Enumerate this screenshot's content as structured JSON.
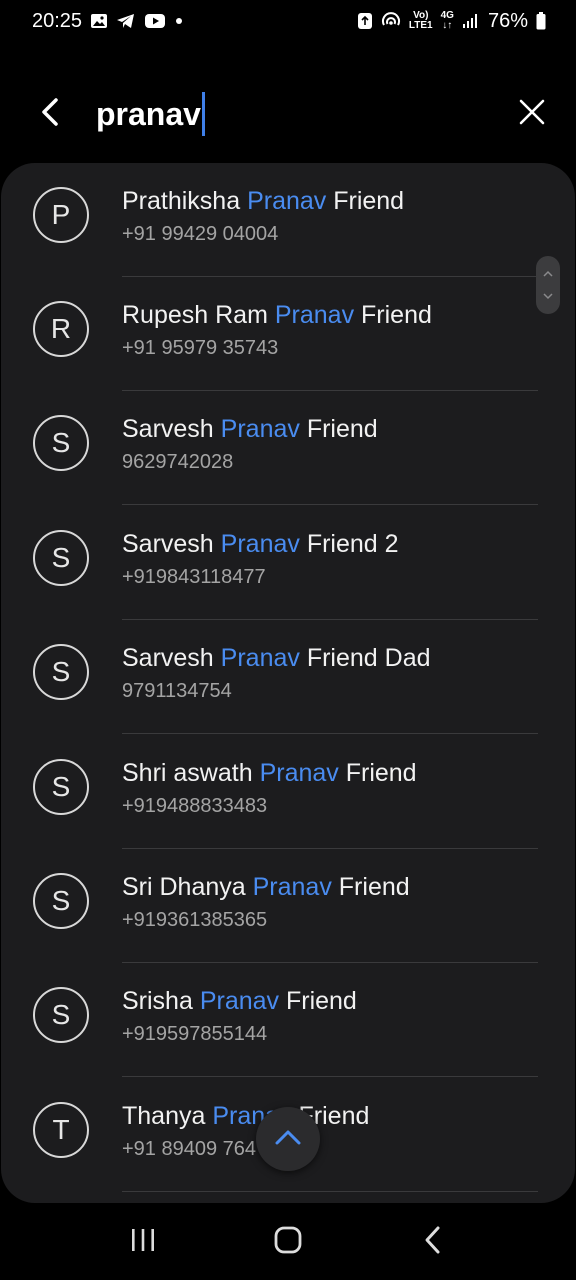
{
  "status_bar": {
    "time": "20:25",
    "battery_percent": "76%",
    "volte_label": "Vo)\nLTE1",
    "network_label": "4G",
    "notification_icons": [
      "gallery-icon",
      "telegram-icon",
      "youtube-icon",
      "dot-icon"
    ],
    "status_icons": [
      "sync-icon",
      "hotspot-icon",
      "volte-icon",
      "4g-icon",
      "signal-icon",
      "battery-icon"
    ]
  },
  "search": {
    "query": "pranav"
  },
  "contacts": [
    {
      "initial": "P",
      "name_before": "Prathiksha ",
      "highlight": "Pranav",
      "name_after": " Friend",
      "phone": "+91 99429 04004"
    },
    {
      "initial": "R",
      "name_before": "Rupesh Ram ",
      "highlight": "Pranav",
      "name_after": " Friend",
      "phone": "+91 95979 35743"
    },
    {
      "initial": "S",
      "name_before": "Sarvesh ",
      "highlight": "Pranav",
      "name_after": " Friend",
      "phone": "9629742028"
    },
    {
      "initial": "S",
      "name_before": "Sarvesh ",
      "highlight": "Pranav",
      "name_after": " Friend 2",
      "phone": "+919843118477"
    },
    {
      "initial": "S",
      "name_before": "Sarvesh ",
      "highlight": "Pranav",
      "name_after": " Friend Dad",
      "phone": "9791134754"
    },
    {
      "initial": "S",
      "name_before": "Shri aswath ",
      "highlight": "Pranav",
      "name_after": " Friend",
      "phone": "+919488833483"
    },
    {
      "initial": "S",
      "name_before": "Sri Dhanya ",
      "highlight": "Pranav",
      "name_after": " Friend",
      "phone": "+919361385365"
    },
    {
      "initial": "S",
      "name_before": "Srisha ",
      "highlight": "Pranav",
      "name_after": " Friend",
      "phone": "+919597855144"
    },
    {
      "initial": "T",
      "name_before": "Thanya ",
      "highlight": "Pranav",
      "name_after": " Friend",
      "phone": "+91 89409 764"
    }
  ],
  "colors": {
    "background": "#000000",
    "panel": "#1c1c1e",
    "highlight": "#4a8cf0",
    "caret": "#3f7fe8",
    "secondary_text": "#a4a4a4"
  },
  "icons": {
    "back": "back-arrow-icon",
    "clear": "close-icon",
    "scroll_top": "chevron-up-icon",
    "nav_recents": "recents-icon",
    "nav_home": "home-icon",
    "nav_back": "nav-back-icon"
  }
}
